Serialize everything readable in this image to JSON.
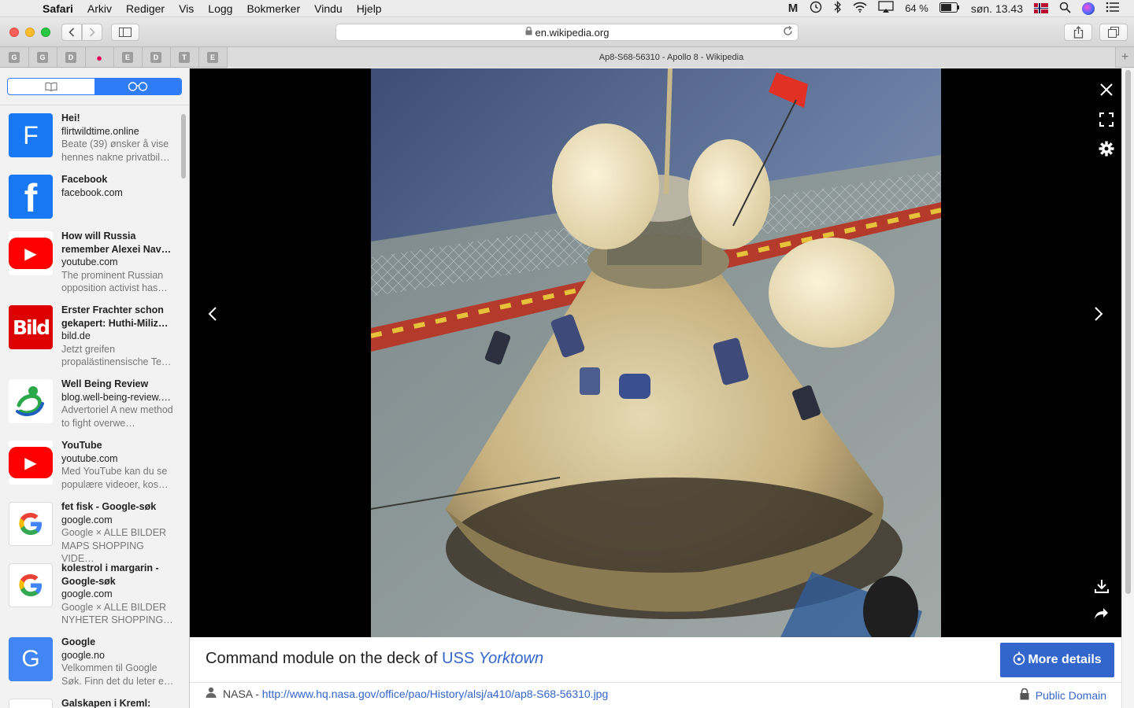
{
  "menubar": {
    "app": "Safari",
    "items": [
      "Arkiv",
      "Rediger",
      "Vis",
      "Logg",
      "Bokmerker",
      "Vindu",
      "Hjelp"
    ],
    "battery": "64 %",
    "clock": "søn. 13.43"
  },
  "toolbar": {
    "url": "en.wikipedia.org"
  },
  "tabbar": {
    "favorites": [
      "G",
      "G",
      "D",
      "",
      "E",
      "D",
      "T",
      "E"
    ],
    "active_tab_title": "Ap8-S68-56310 - Apollo 8 - Wikipedia",
    "add_tab": "+"
  },
  "reading_list": [
    {
      "title": "Hei!",
      "domain": "flirtwildtime.online",
      "desc": "Beate (39) ønsker å vise hennes nakne privatbil…",
      "icon": "F",
      "icon_color": "#1877f2"
    },
    {
      "title": "Facebook",
      "domain": "facebook.com",
      "desc": "",
      "icon": "f",
      "icon_color": "#1877f2"
    },
    {
      "title": "How will Russia remember Alexei Nav…",
      "domain": "youtube.com",
      "desc": "The prominent Russian opposition activist has…",
      "icon": "▶",
      "icon_color": "#ff0000"
    },
    {
      "title": "Erster Frachter schon gekapert: Huthi-Miliz…",
      "domain": "bild.de",
      "desc": "Jetzt greifen propalästinensische Te…",
      "icon": "Bild",
      "icon_color": "#dd0000"
    },
    {
      "title": "Well Being Review",
      "domain": "blog.well-being-review.…",
      "desc": "Advertoriel A new method to fight overwe…",
      "icon": "",
      "icon_color": "#2aa84a"
    },
    {
      "title": "YouTube",
      "domain": "youtube.com",
      "desc": "Med YouTube kan du se populære videoer, kos…",
      "icon": "▶",
      "icon_color": "#ff0000"
    },
    {
      "title": "fet fisk - Google-søk",
      "domain": "google.com",
      "desc": "Google × ALLE BILDER MAPS SHOPPING VIDE…",
      "icon": "G",
      "icon_color": "#ffffff"
    },
    {
      "title": "kolestrol i margarin - Google-søk",
      "domain": "google.com",
      "desc": "Google × ALLE BILDER NYHETER SHOPPING…",
      "icon": "G",
      "icon_color": "#ffffff"
    },
    {
      "title": "Google",
      "domain": "google.no",
      "desc": "Velkommen til Google Søk. Finn det du leter e…",
      "icon": "G",
      "icon_color": "#4285f4"
    },
    {
      "title": "Galskapen i Kreml:",
      "domain": "",
      "desc": "",
      "icon": "",
      "icon_color": "#ffffff"
    }
  ],
  "viewer": {
    "caption_prefix": "Command module on the deck of ",
    "caption_link_1": "USS",
    "caption_link_2": "Yorktown",
    "more_details": "More details",
    "credit_author": "NASA - ",
    "credit_url": "http://www.hq.nasa.gov/office/pao/History/alsj/a410/ap8-S68-56310.jpg",
    "license": "Public Domain"
  }
}
